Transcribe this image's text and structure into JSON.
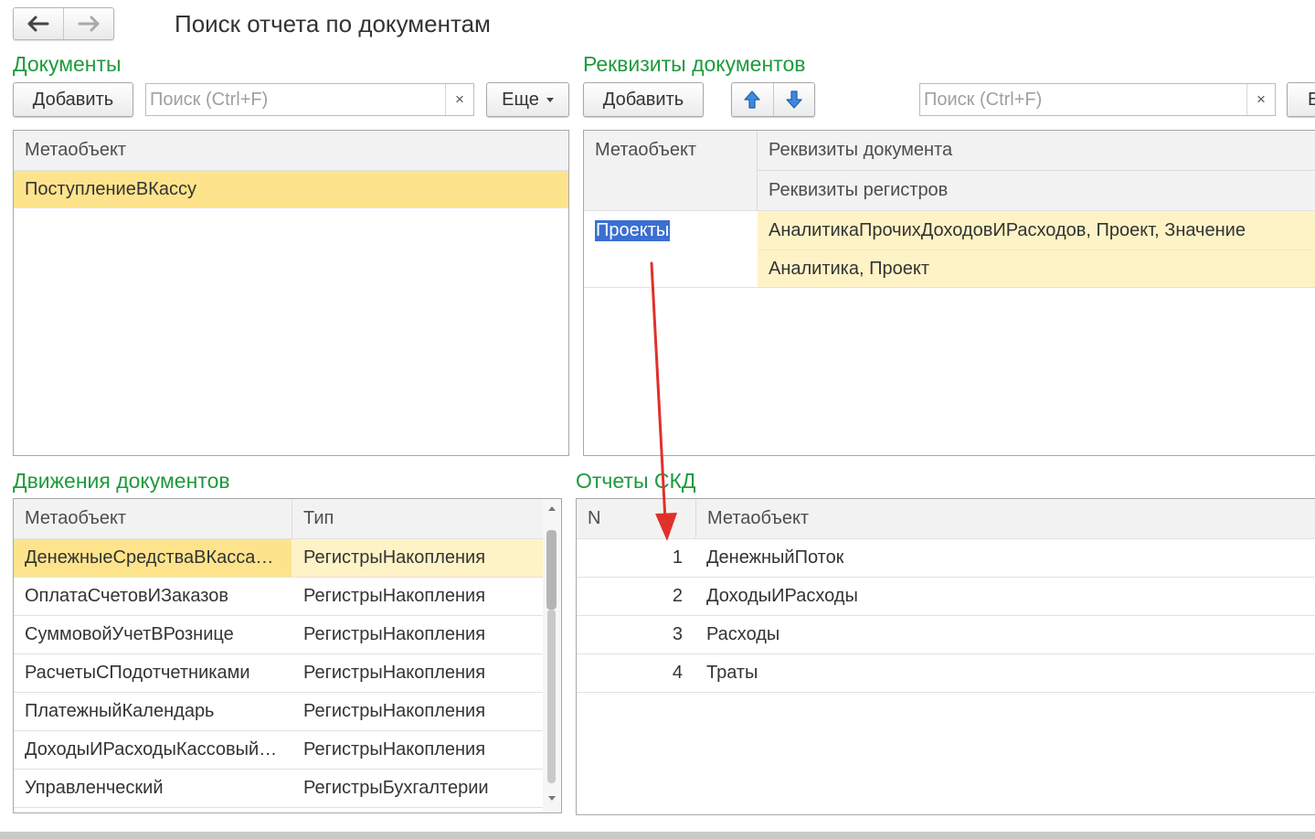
{
  "window": {
    "title": "Поиск отчета по документам"
  },
  "icons": {
    "back": "arrow-left-icon",
    "forward": "arrow-right-icon",
    "move_up": "arrow-up-icon",
    "move_down": "arrow-down-icon",
    "clear": "close-icon",
    "more": "chevron-down-icon"
  },
  "colors": {
    "section_title": "#1d9a3c",
    "row_selected": "#fde48c",
    "row_highlight": "#fef3c6",
    "text_selection": "#3b6fd1",
    "annotation_arrow": "#e0302a"
  },
  "documents": {
    "title": "Документы",
    "add_label": "Добавить",
    "search_placeholder": "Поиск (Ctrl+F)",
    "clear_label": "×",
    "more_label": "Еще",
    "columns": [
      "Метаобъект"
    ],
    "rows": [
      "ПоступлениеВКассу"
    ]
  },
  "requisites": {
    "title": "Реквизиты документов",
    "add_label": "Добавить",
    "search_placeholder": "Поиск (Ctrl+F)",
    "clear_label": "×",
    "more_label_partial": "Е",
    "columns": {
      "metaobject": "Метаобъект",
      "doc_requisites": "Реквизиты документа",
      "reg_requisites": "Реквизиты регистров"
    },
    "rows": [
      {
        "metaobject": "Проекты",
        "doc_requisites": "АналитикаПрочихДоходовИРасходов, Проект, Значение",
        "reg_requisites": "Аналитика, Проект"
      }
    ]
  },
  "movements": {
    "title": "Движения документов",
    "columns": [
      "Метаобъект",
      "Тип"
    ],
    "rows": [
      {
        "metaobject": "ДенежныеСредстваВКассахККМ",
        "type": "РегистрыНакопления"
      },
      {
        "metaobject": "ОплатаСчетовИЗаказов",
        "type": "РегистрыНакопления"
      },
      {
        "metaobject": "СуммовойУчетВРознице",
        "type": "РегистрыНакопления"
      },
      {
        "metaobject": "РасчетыСПодотчетниками",
        "type": "РегистрыНакопления"
      },
      {
        "metaobject": "ПлатежныйКалендарь",
        "type": "РегистрыНакопления"
      },
      {
        "metaobject": "ДоходыИРасходыКассовыйМетод",
        "type": "РегистрыНакопления"
      },
      {
        "metaobject": "Управленческий",
        "type": "РегистрыБухгалтерии"
      }
    ]
  },
  "reports": {
    "title": "Отчеты СКД",
    "columns": [
      "N",
      "Метаобъект"
    ],
    "rows": [
      {
        "n": "1",
        "metaobject": "ДенежныйПоток"
      },
      {
        "n": "2",
        "metaobject": "ДоходыИРасходы"
      },
      {
        "n": "3",
        "metaobject": "Расходы"
      },
      {
        "n": "4",
        "metaobject": "Траты"
      }
    ]
  }
}
